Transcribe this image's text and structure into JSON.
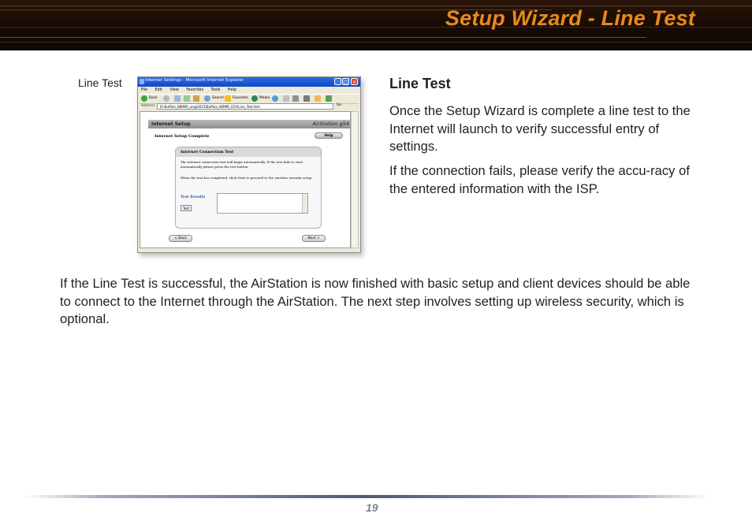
{
  "header": {
    "title": "Setup Wizard - Line Test"
  },
  "figure": {
    "caption": "Line Test",
    "window": {
      "title": "Internet Settings - Microsoft Internet Explorer",
      "menu": [
        "File",
        "Edit",
        "View",
        "Favorites",
        "Tools",
        "Help"
      ],
      "toolbar": {
        "back": "Back",
        "search": "Search",
        "favorites": "Favorites",
        "media": "Media"
      },
      "address_label": "Address",
      "address_value": "D:\\Buffalo_WBMR\\_wsg\\2023\\Buffalo_WBMR_G54\\Line_Test.htm",
      "go_label": "Go",
      "page": {
        "section_bar": "Internet Setup",
        "brand": "AirStation g54",
        "heading": "Internet Setup Complete",
        "help_button": "Help",
        "panel": {
          "title": "Internet Connection Test",
          "text1": "The internet connection test will begin automatically. If the test fails to start automatically please press the test button.",
          "text2": "When the test has completed, click Next to proceed to the wireless security setup.",
          "results_label": "Test Results",
          "test_button": "Test"
        },
        "back_button": "< Back",
        "next_button": "Next >"
      }
    }
  },
  "section": {
    "heading": "Line Test",
    "para1": "Once the Setup Wizard is complete a line test to the Internet will launch to verify successful entry of settings.",
    "para2": "If the connection fails, please verify the accu-racy of the entered information with the ISP."
  },
  "body": {
    "para": "If the Line Test is successful, the AirStation is now finished with basic setup and client devices should be able to connect to the Internet through the AirStation. The next step involves setting up wireless security, which is optional."
  },
  "footer": {
    "page_number": "19"
  },
  "colors": {
    "title_orange": "#e98a1a",
    "banner_dark": "#1a0c05",
    "page_number": "#7c8598"
  }
}
